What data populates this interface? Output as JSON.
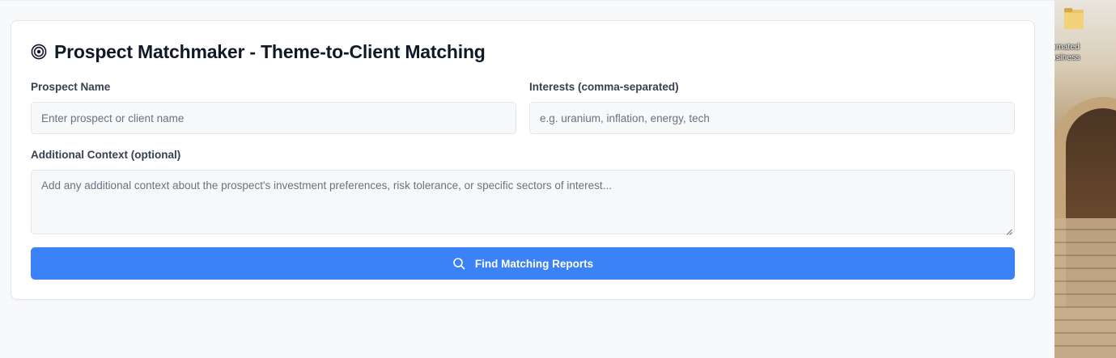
{
  "header": {
    "title": "Prospect Matchmaker - Theme-to-Client Matching",
    "title_icon": "target-icon"
  },
  "form": {
    "prospect_name": {
      "label": "Prospect Name",
      "placeholder": "Enter prospect or client name",
      "value": ""
    },
    "interests": {
      "label": "Interests (comma-separated)",
      "placeholder": "e.g. uranium, inflation, energy, tech",
      "value": ""
    },
    "additional_context": {
      "label": "Additional Context (optional)",
      "placeholder": "Add any additional context about the prospect's investment preferences, risk tolerance, or specific sectors of interest...",
      "value": ""
    },
    "submit": {
      "label": "Find Matching Reports",
      "icon": "search-icon"
    }
  },
  "desktop": {
    "shortcut_label_line1": "omated",
    "shortcut_label_line2": "usiness",
    "shortcut_icon": "folder-icon"
  },
  "colors": {
    "accent": "#3b82f6",
    "page_bg": "#f8f9fa",
    "card_bg": "#ffffff",
    "field_bg": "#f6f8f9"
  }
}
